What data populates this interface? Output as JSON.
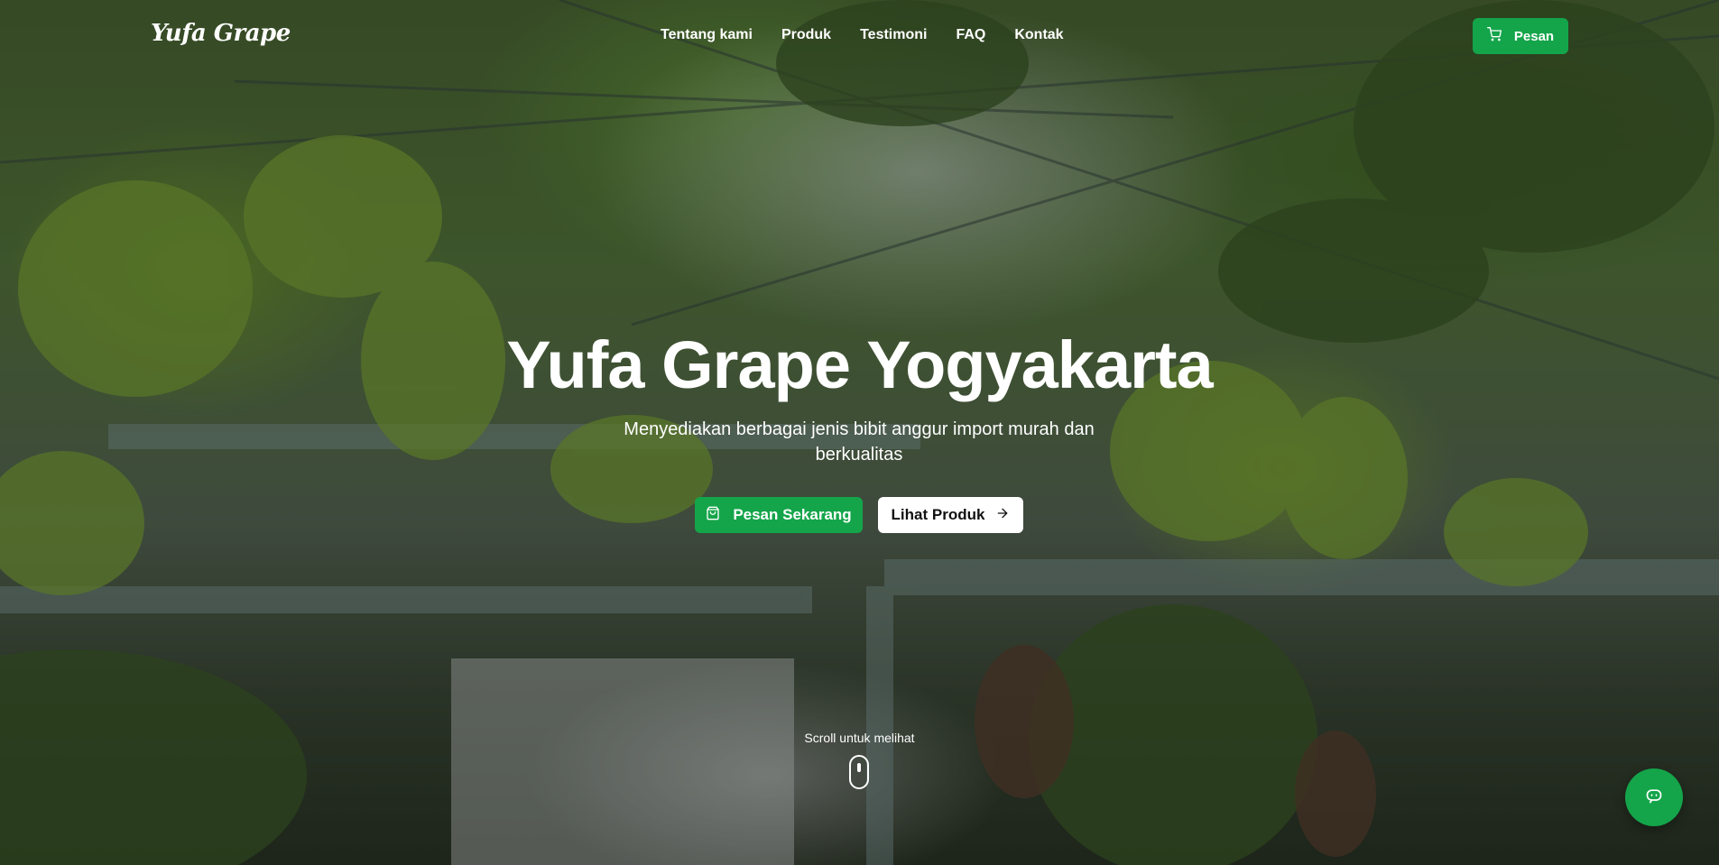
{
  "brand": {
    "logo_text": "Yufa Grape"
  },
  "nav": {
    "items": [
      {
        "label": "Tentang kami"
      },
      {
        "label": "Produk"
      },
      {
        "label": "Testimoni"
      },
      {
        "label": "FAQ"
      },
      {
        "label": "Kontak"
      }
    ],
    "order_button": {
      "label": "Pesan",
      "icon": "cart-icon"
    }
  },
  "hero": {
    "title": "Yufa Grape Yogyakarta",
    "subtitle": "Menyediakan berbagai jenis bibit anggur import murah dan berkualitas",
    "primary_button": {
      "label": "Pesan Sekarang",
      "icon": "shopping-bag-icon"
    },
    "secondary_button": {
      "label": "Lihat Produk",
      "icon": "arrow-right-icon"
    },
    "scroll_hint": "Scroll untuk melihat"
  },
  "chat": {
    "icon": "chat-icon"
  },
  "colors": {
    "accent": "#14a54a",
    "text_on_dark": "#ffffff"
  }
}
